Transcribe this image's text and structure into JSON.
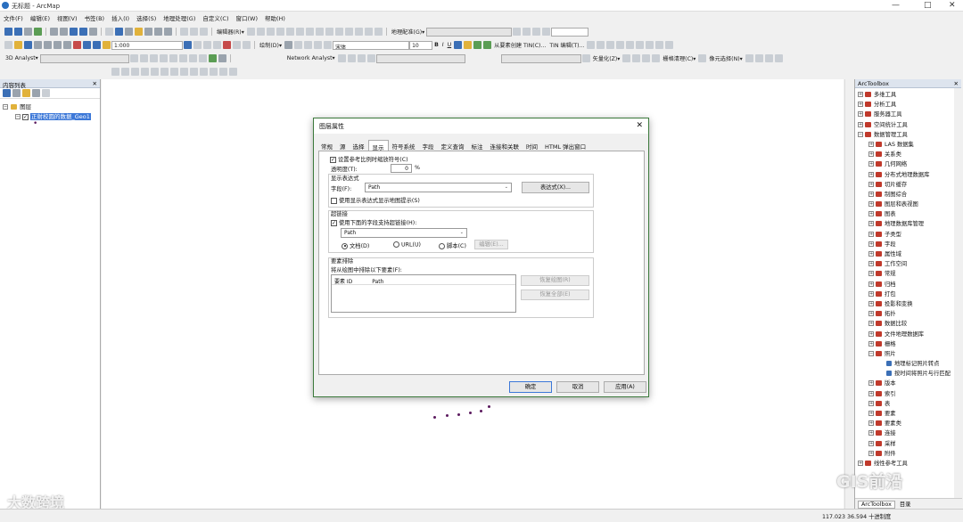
{
  "window": {
    "title": "无标题 - ArcMap",
    "controls": [
      "—",
      "□",
      "✕"
    ]
  },
  "menu": [
    "文件(F)",
    "编辑(E)",
    "视图(V)",
    "书签(B)",
    "插入(I)",
    "选择(S)",
    "地理处理(G)",
    "自定义(C)",
    "窗口(W)",
    "帮助(H)"
  ],
  "toolbar": {
    "scale": "1:000",
    "editor": "编辑器(R)▾",
    "georef": "地理配准(G)▾",
    "drawing": "绘制(D)▾",
    "font": "宋体",
    "font_size": "10",
    "tin_hint": "从要素创建 TIN(C)...",
    "tin_edit": "TIN 编辑(T)...",
    "analyst3d": "3D Analyst▾",
    "network": "Network Analyst▾",
    "vectorize": "矢量化(Z)▾",
    "raster_clean": "栅格清理(C)▾",
    "cell_select": "像元选择(N)▾"
  },
  "toc": {
    "header": "内容列表",
    "root": "图层",
    "layer": "正射校圆的数据_Geo1"
  },
  "arctoolbox": {
    "header": "ArcToolbox",
    "items": [
      {
        "label": "多维工具",
        "level": 0,
        "exp": "+"
      },
      {
        "label": "分析工具",
        "level": 0,
        "exp": "+"
      },
      {
        "label": "服务器工具",
        "level": 0,
        "exp": "+"
      },
      {
        "label": "空间统计工具",
        "level": 0,
        "exp": "+"
      },
      {
        "label": "数据管理工具",
        "level": 0,
        "exp": "−"
      },
      {
        "label": "LAS 数据集",
        "level": 1,
        "exp": "+"
      },
      {
        "label": "关系类",
        "level": 1,
        "exp": "+"
      },
      {
        "label": "几何网络",
        "level": 1,
        "exp": "+"
      },
      {
        "label": "分布式地理数据库",
        "level": 1,
        "exp": "+"
      },
      {
        "label": "切片缓存",
        "level": 1,
        "exp": "+"
      },
      {
        "label": "制图综合",
        "level": 1,
        "exp": "+"
      },
      {
        "label": "图层和表视图",
        "level": 1,
        "exp": "+"
      },
      {
        "label": "图表",
        "level": 1,
        "exp": "+"
      },
      {
        "label": "地理数据库管理",
        "level": 1,
        "exp": "+"
      },
      {
        "label": "子类型",
        "level": 1,
        "exp": "+"
      },
      {
        "label": "字段",
        "level": 1,
        "exp": "+"
      },
      {
        "label": "属性域",
        "level": 1,
        "exp": "+"
      },
      {
        "label": "工作空间",
        "level": 1,
        "exp": "+"
      },
      {
        "label": "常规",
        "level": 1,
        "exp": "+"
      },
      {
        "label": "归档",
        "level": 1,
        "exp": "+"
      },
      {
        "label": "打包",
        "level": 1,
        "exp": "+"
      },
      {
        "label": "投影和变换",
        "level": 1,
        "exp": "+"
      },
      {
        "label": "拓扑",
        "level": 1,
        "exp": "+"
      },
      {
        "label": "数据比较",
        "level": 1,
        "exp": "+"
      },
      {
        "label": "文件地理数据库",
        "level": 1,
        "exp": "+"
      },
      {
        "label": "栅格",
        "level": 1,
        "exp": "+"
      },
      {
        "label": "照片",
        "level": 1,
        "exp": "−"
      },
      {
        "label": "地理标记照片转点",
        "level": 2,
        "exp": ""
      },
      {
        "label": "按时间将照片与行匹配",
        "level": 2,
        "exp": ""
      },
      {
        "label": "版本",
        "level": 1,
        "exp": "+"
      },
      {
        "label": "索引",
        "level": 1,
        "exp": "+"
      },
      {
        "label": "表",
        "level": 1,
        "exp": "+"
      },
      {
        "label": "要素",
        "level": 1,
        "exp": "+"
      },
      {
        "label": "要素类",
        "level": 1,
        "exp": "+"
      },
      {
        "label": "连接",
        "level": 1,
        "exp": "+"
      },
      {
        "label": "采样",
        "level": 1,
        "exp": "+"
      },
      {
        "label": "附件",
        "level": 1,
        "exp": "+"
      },
      {
        "label": "线性参考工具",
        "level": 0,
        "exp": "+"
      }
    ],
    "tab_toolbox": "ArcToolbox",
    "tab_catalog": "目录"
  },
  "status": {
    "coords": "117.023  36.594 十进制度"
  },
  "watermark": {
    "left": "大数跨境",
    "right": "GIS前沿"
  },
  "dialog": {
    "title": "图层属性",
    "tabs": [
      "常规",
      "源",
      "选择",
      "显示",
      "符号系统",
      "字段",
      "定义查询",
      "标注",
      "连接和关联",
      "时间",
      "HTML 弹出窗口"
    ],
    "active_tab": "显示",
    "scale_symbols": "设置参考比例时缩放符号(C)",
    "transparency_label": "透明度(T):",
    "transparency_value": "0",
    "transparency_unit": "%",
    "display_expr_title": "显示表达式",
    "field_label": "字段(F):",
    "field_value": "Path",
    "expression_btn": "表达式(X)...",
    "use_expr_tips": "使用显示表达式显示地图提示(S)",
    "hyperlink_title": "超链接",
    "use_hyperlink": "使用下面的字段支持超链接(H):",
    "hyperlink_field": "Path",
    "opt_document": "文档(D)",
    "opt_url": "URL(U)",
    "opt_script": "脚本(C)",
    "edit_btn": "编辑(E)...",
    "feature_exclusion_title": "要素排除",
    "exclude_label": "将从绘图中排除以下要素(F):",
    "col_id": "要素 ID",
    "col_path": "Path",
    "restore_draw": "恢复绘图(R)",
    "restore_all": "恢复全部(E)",
    "ok": "确定",
    "cancel": "取消",
    "apply": "应用(A)"
  }
}
